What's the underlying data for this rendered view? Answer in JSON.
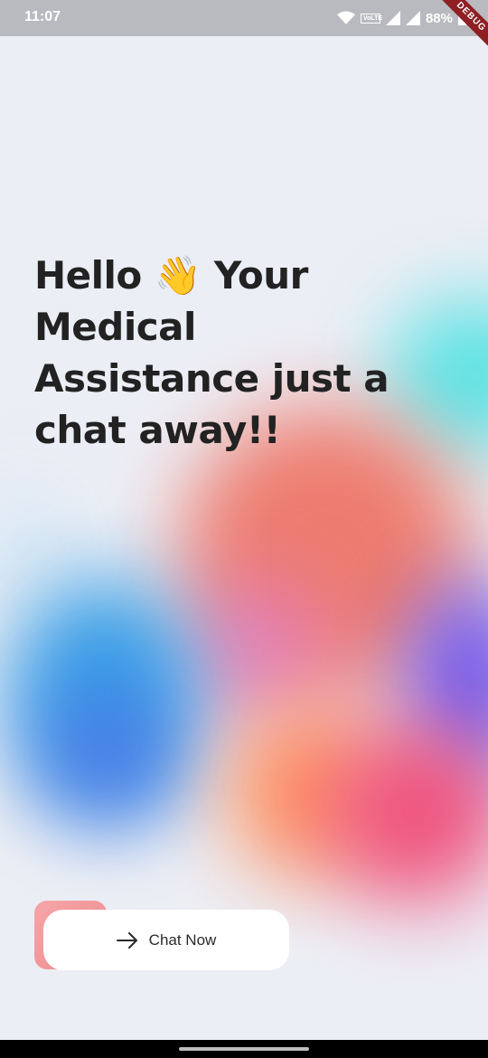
{
  "status_bar": {
    "time": "11:07",
    "network_label": "VoLTE",
    "battery_percent": "88%",
    "icons": [
      "wifi-icon",
      "lte-icon",
      "signal-icon",
      "signal-icon",
      "battery-icon"
    ]
  },
  "debug_banner": "DEBUG",
  "headline": "Hello 👋 Your Medical Assistance just a chat away!!",
  "cta": {
    "label": "Chat Now",
    "icon": "arrow-right-icon"
  },
  "colors": {
    "background": "#ECEEF5",
    "headline": "#222222",
    "cta_accent": "#F5A6A8"
  }
}
